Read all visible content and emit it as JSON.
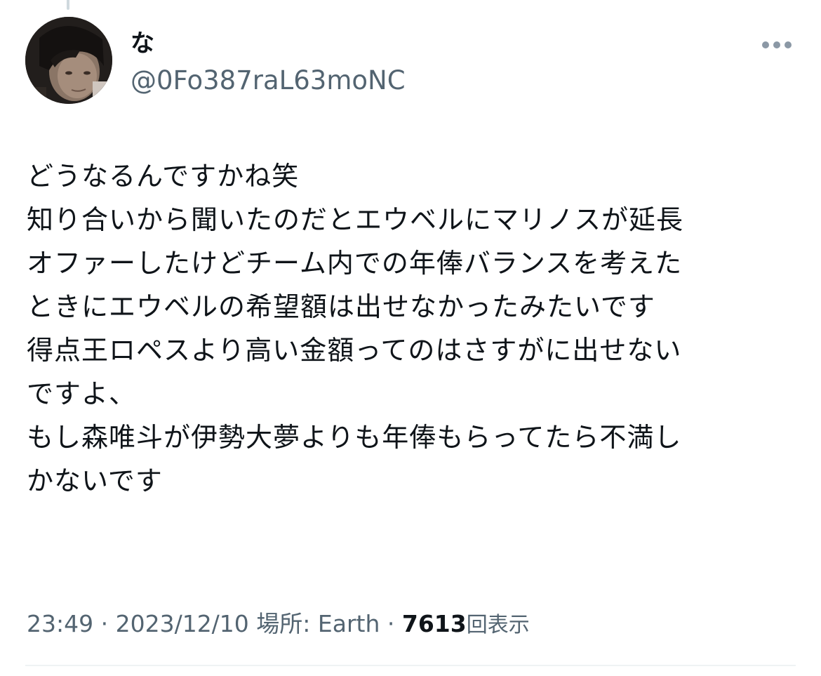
{
  "author": {
    "display_name": "な",
    "handle": "@0Fo387raL63moNC",
    "avatar_icon": "user-photo-avatar"
  },
  "more_icon": "ellipsis-horizontal-icon",
  "tweet": {
    "lines": [
      "どうなるんですかね笑",
      "知り合いから聞いたのだとエウベルにマリノスが延長",
      "オファーしたけどチーム内での年俸バランスを考えた",
      "ときにエウベルの希望額は出せなかったみたいです",
      "得点王ロペスより高い金額ってのはさすがに出せない",
      "ですよ、",
      "もし森唯斗が伊勢大夢よりも年俸もらってたら不満し",
      "かないです"
    ]
  },
  "meta": {
    "time": "23:49",
    "sep1": " · ",
    "date": "2023/12/10",
    "location": " 場所: Earth",
    "sep2": " · ",
    "views_count": "7613",
    "views_label": "回表示"
  },
  "colors": {
    "text_primary": "#0f1419",
    "text_secondary": "#536471",
    "divider": "#eff3f4",
    "more_icon": "#8b98a5"
  }
}
